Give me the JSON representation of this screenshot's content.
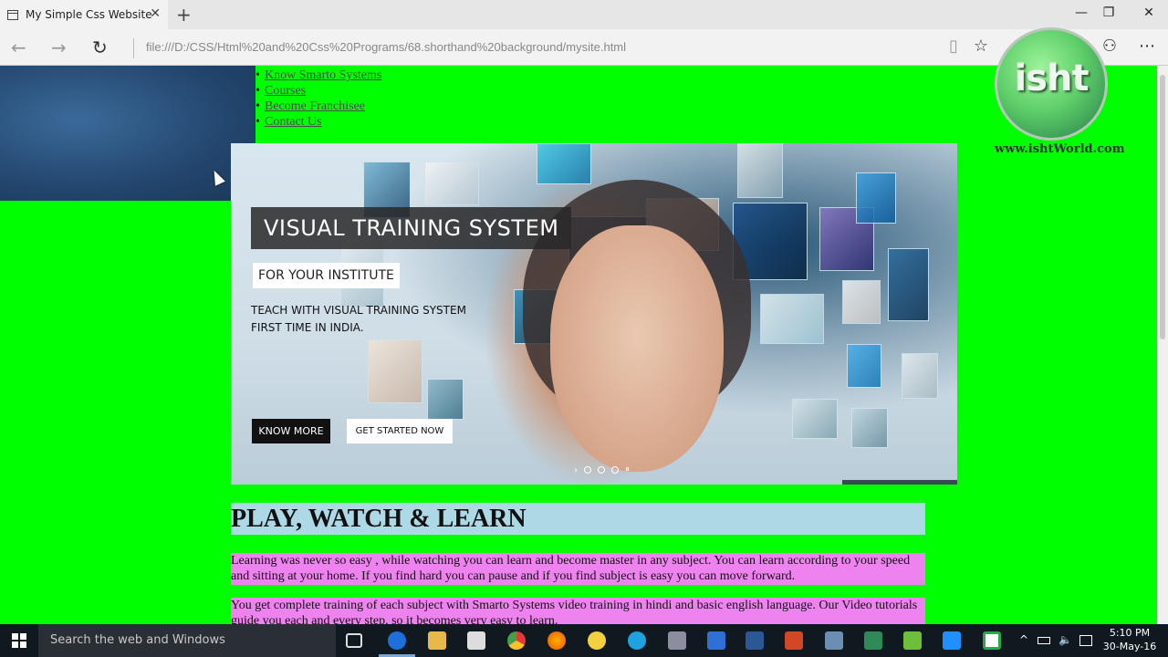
{
  "browser": {
    "tab_title": "My Simple Css Website",
    "tab_close": "✕",
    "new_tab": "+",
    "address": "file:///D:/CSS/Html%20and%20Css%20Programs/68.shorthand%20background/mysite.html",
    "back": "←",
    "forward": "→",
    "refresh": "↻",
    "minimize": "—",
    "maximize": "❐",
    "close": "✕",
    "tools": {
      "reading_view": "▯",
      "favorite": "☆",
      "hub": "≡",
      "web_note": "✎",
      "share": "⚇",
      "more": "⋯"
    }
  },
  "page": {
    "nav": [
      "Know Smarto Systems",
      "Courses",
      "Become Franchisee",
      "Contact Us"
    ],
    "banner": {
      "title": "VISUAL TRAINING SYSTEM",
      "subtitle": "FOR YOUR INSTITUTE",
      "line1": "TEACH WITH VISUAL TRAINING SYSTEM",
      "line2": "FIRST TIME IN INDIA.",
      "btn_primary": "KNOW MORE",
      "btn_secondary": "GET STARTED NOW",
      "next_arrow": "›",
      "pause": "⏸"
    },
    "heading": "PLAY, WATCH & LEARN",
    "para1": "Learning was never so easy , while watching you can learn and become master in any subject. You can learn according to your speed and sitting at your home. If you find hard you can pause and if you find subject is easy you can move forward.",
    "para2": "You get complete training of each subject with Smarto Systems video training in hindi and basic english language. Our Video tutorials guide you each and every step, so it becomes very easy to learn."
  },
  "watermark": {
    "logo_text": "isht",
    "url": "www.ishtWorld.com"
  },
  "taskbar": {
    "search_placeholder": "Search the web and Windows",
    "time": "5:10 PM",
    "date": "30-May-16",
    "tray_chevron": "^"
  },
  "colors": {
    "page_bg": "#00ff00",
    "heading_bg": "#add8e6",
    "para_bg": "#ee82ee"
  }
}
